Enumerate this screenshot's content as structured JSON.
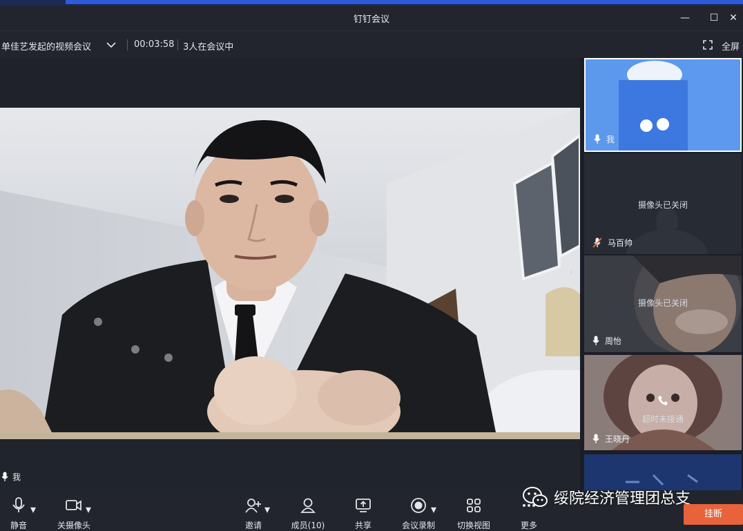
{
  "window": {
    "title": "钉钉会议",
    "controls": [
      "minimize-icon",
      "maximize-icon",
      "close-icon"
    ]
  },
  "meeting": {
    "name": "单佳艺发起的视频会议",
    "duration": "00:03:58",
    "participants_count": "3人在会议中",
    "fullscreen_label": "全屏"
  },
  "main_video": {
    "speaker_label": "我"
  },
  "sidebar": {
    "tiles": [
      {
        "name": "我",
        "status": "",
        "mic": "mic-icon",
        "active": true
      },
      {
        "name": "马百帅",
        "status": "摄像头已关闭",
        "mic": "mic-muted-icon"
      },
      {
        "name": "周怡",
        "status": "摄像头已关闭",
        "mic": "mic-icon"
      },
      {
        "name": "王晓丹",
        "status": "超时未接通",
        "mic": "mic-icon",
        "status_icon": "phone-icon"
      }
    ]
  },
  "toolbar": {
    "mute_label": "静音",
    "camera_label": "关摄像头",
    "invite_label": "邀请",
    "members_label": "成员(10)",
    "share_label": "共享",
    "record_label": "会议录制",
    "switch_view_label": "切换视图",
    "more_label": "更多",
    "hangup_label": "挂断"
  },
  "watermark": {
    "text": "绥院经济管理团总支"
  },
  "colors": {
    "hangup": "#e8623c",
    "titlebar": "#22252d",
    "accent_blue": "#2f5bd8"
  }
}
